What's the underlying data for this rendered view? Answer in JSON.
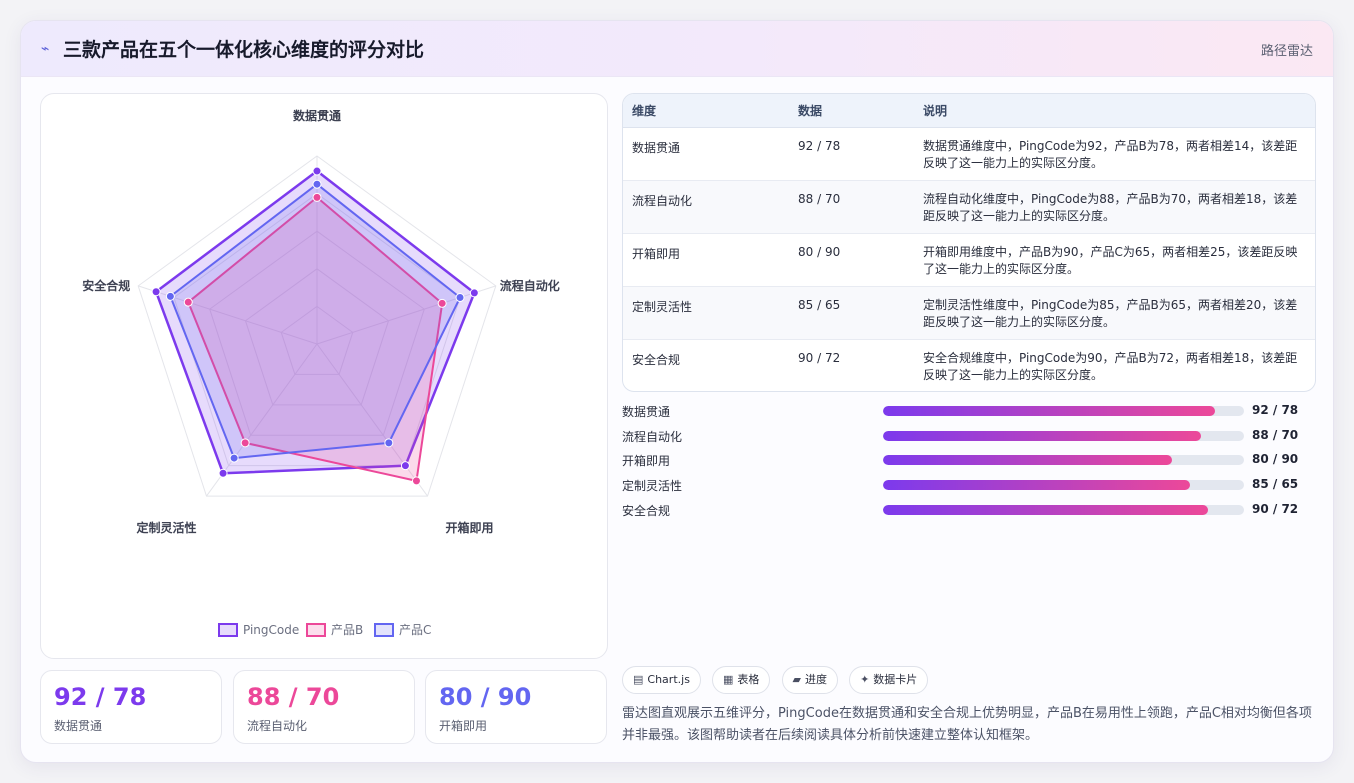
{
  "header": {
    "icon": "⌁",
    "title": "三款产品在五个一体化核心维度的评分对比",
    "tag": "路径雷达"
  },
  "colors": {
    "pingcode": "#7c3aed",
    "productB": "#ec4899",
    "productC": "#6366f1"
  },
  "chart_data": {
    "type": "radar",
    "categories": [
      "数据贯通",
      "流程自动化",
      "开箱即用",
      "定制灵活性",
      "安全合规"
    ],
    "series": [
      {
        "name": "PingCode",
        "values": [
          92,
          88,
          80,
          85,
          90
        ],
        "color": "#7c3aed"
      },
      {
        "name": "产品B",
        "values": [
          78,
          70,
          90,
          65,
          72
        ],
        "color": "#ec4899"
      },
      {
        "name": "产品C",
        "values": [
          85,
          80,
          65,
          75,
          82
        ],
        "color": "#6366f1"
      }
    ],
    "rlim": [
      0,
      100
    ],
    "grid": true,
    "legend": "bottom"
  },
  "table": {
    "headers": [
      "维度",
      "数据",
      "说明"
    ],
    "rows": [
      {
        "dim": "数据贯通",
        "data": "92 / 78",
        "desc": "数据贯通维度中，PingCode为92，产品B为78，两者相差14，该差距反映了这一能力上的实际区分度。"
      },
      {
        "dim": "流程自动化",
        "data": "88 / 70",
        "desc": "流程自动化维度中，PingCode为88，产品B为70，两者相差18，该差距反映了这一能力上的实际区分度。"
      },
      {
        "dim": "开箱即用",
        "data": "80 / 90",
        "desc": "开箱即用维度中，产品B为90，产品C为65，两者相差25，该差距反映了这一能力上的实际区分度。"
      },
      {
        "dim": "定制灵活性",
        "data": "85 / 65",
        "desc": "定制灵活性维度中，PingCode为85，产品B为65，两者相差20，该差距反映了这一能力上的实际区分度。"
      },
      {
        "dim": "安全合规",
        "data": "90 / 72",
        "desc": "安全合规维度中，PingCode为90，产品B为72，两者相差18，该差距反映了这一能力上的实际区分度。"
      }
    ]
  },
  "bars": [
    {
      "label": "数据贯通",
      "value": "92 / 78",
      "fill_pct": 92
    },
    {
      "label": "流程自动化",
      "value": "88 / 70",
      "fill_pct": 88
    },
    {
      "label": "开箱即用",
      "value": "80 / 90",
      "fill_pct": 80
    },
    {
      "label": "定制灵活性",
      "value": "85 / 65",
      "fill_pct": 85
    },
    {
      "label": "安全合规",
      "value": "90 / 72",
      "fill_pct": 90
    }
  ],
  "stats": [
    {
      "value": "92 / 78",
      "label": "数据贯通",
      "color": "#7c3aed"
    },
    {
      "value": "88 / 70",
      "label": "流程自动化",
      "color": "#ec4899"
    },
    {
      "value": "80 / 90",
      "label": "开箱即用",
      "color": "#6366f1"
    }
  ],
  "chips": [
    {
      "icon": "▤",
      "label": "Chart.js"
    },
    {
      "icon": "▦",
      "label": "表格"
    },
    {
      "icon": "▰",
      "label": "进度"
    },
    {
      "icon": "✦",
      "label": "数据卡片"
    }
  ],
  "note": "雷达图直观展示五维评分，PingCode在数据贯通和安全合规上优势明显，产品B在易用性上领跑，产品C相对均衡但各项并非最强。该图帮助读者在后续阅读具体分析前快速建立整体认知框架。"
}
